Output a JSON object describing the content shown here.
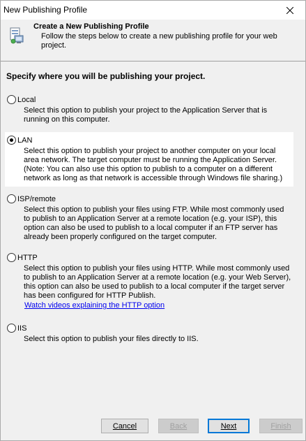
{
  "window": {
    "title": "New Publishing Profile"
  },
  "header": {
    "title": "Create a New Publishing Profile",
    "description": "Follow the steps below to create a new publishing profile for your web project.",
    "icon": "publish-profile-icon"
  },
  "main": {
    "heading": "Specify where you will be publishing your project.",
    "options": [
      {
        "label": "Local",
        "description": "Select this option to publish your project to the Application Server that is running on this computer.",
        "selected": false
      },
      {
        "label": "LAN",
        "description": "Select this option to publish your project to another computer on your local area network.  The target computer must be running the Application Server. (Note: You can also use this option to publish to a computer on a different network as long as that network is accessible through Windows file sharing.)",
        "selected": true
      },
      {
        "label": "ISP/remote",
        "description": "Select this option to publish your files using FTP. While most commonly used to publish to an Application Server at a remote location (e.g. your ISP), this option can also be used to publish to a local computer if an FTP server has already been properly configured on the target computer.",
        "selected": false
      },
      {
        "label": "HTTP",
        "description": "Select this option to publish your files using HTTP. While most commonly used to publish to an Application Server at a remote location (e.g. your Web Server), this option can also be used to publish to a local computer if the target server has been configured for HTTP Publish.",
        "link": "Watch videos explaining the HTTP option",
        "selected": false
      },
      {
        "label": "IIS",
        "description": "Select this option to publish your files directly to IIS.",
        "selected": false
      }
    ]
  },
  "footer": {
    "cancel": "Cancel",
    "back": "Back",
    "next": "Next",
    "finish": "Finish"
  },
  "colors": {
    "accent": "#0078d7",
    "link": "#0000ee",
    "background": "#f0f0f0"
  }
}
